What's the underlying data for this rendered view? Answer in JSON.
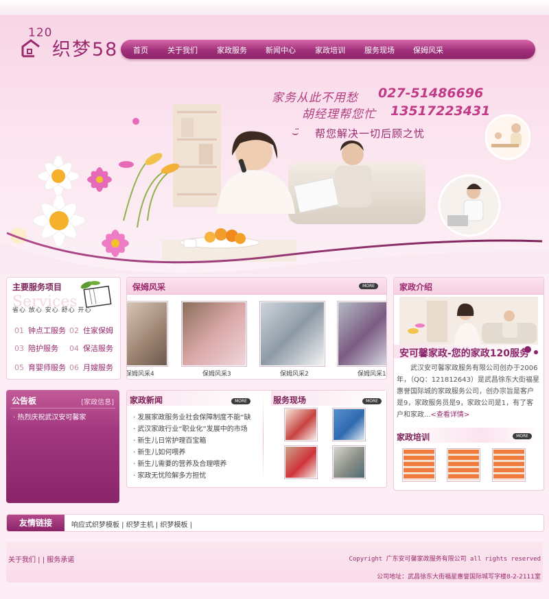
{
  "logo": {
    "number": "120",
    "brand": "织梦58"
  },
  "nav": {
    "items": [
      "首页",
      "关于我们",
      "家政服务",
      "新闻中心",
      "家政培训",
      "服务现场",
      "保姆风采"
    ]
  },
  "banner": {
    "slogan_line1": "家务从此不用愁",
    "slogan_line2": "胡经理帮您忙",
    "phone1": "027-51486696",
    "phone2": "13517223431",
    "slogan_line3": "帮您解决一切后顾之忧",
    "slogan_icon": "smile-icon"
  },
  "services": {
    "title": "主要服务项目",
    "bg_word": "Services",
    "tags": "省心  放心  安心  舒心  开心",
    "items": [
      {
        "num": "01",
        "label": "钟点工服务"
      },
      {
        "num": "02",
        "label": "住家保姆"
      },
      {
        "num": "03",
        "label": "陪护服务"
      },
      {
        "num": "04",
        "label": "保洁服务"
      },
      {
        "num": "05",
        "label": "育婴师服务"
      },
      {
        "num": "06",
        "label": "月嫂服务"
      }
    ]
  },
  "more_label": "MORE",
  "nanny": {
    "title": "保姆风采",
    "captions": [
      "保姆风采4",
      "保姆风采3",
      "保姆风采2",
      "保姆风采1"
    ]
  },
  "about": {
    "title": "家政介绍",
    "headline": "安可馨家政-您的家政120服务",
    "text": "武汉安可馨家政服务有限公司创办于2006年，（QQ：121812643）是武昌徐东大街福星惠誉国际城的家政服务公司，创办宗旨是客户是9，家政服务员是9，家政公司是1，有了客户和家政...",
    "detail_link": "<查看详情>"
  },
  "notice": {
    "title": "公告板",
    "tag": "[家政信息]",
    "items": [
      "· 热烈庆祝武汉安可馨家"
    ]
  },
  "news": {
    "title": "家政新闻",
    "items": [
      "· 发展家政服务业社会保障制度不能“缺",
      "· 武汉家政行业“职业化”发展中的市场",
      "· 新生儿日常护理百宝箱",
      "· 新生儿如何喂养",
      "· 新生儿需要的营养及合理喂养",
      "· 家政无忧险解多方担忧"
    ]
  },
  "site": {
    "title": "服务现场"
  },
  "training": {
    "title": "家政培训"
  },
  "friend": {
    "title": "友情链接",
    "links": "响应式织梦模板  |  织梦主机  |  织梦模板  |"
  },
  "footer": {
    "left": "关于我们  |  |  服务承诺",
    "copyright": "Copyright 广东安可馨家政服务有限公司 all rights reserved",
    "address": "公司地址：武昌徐东大街福星惠誉国际城写字楼8-2-2111室"
  },
  "colors": {
    "brand": "#9a2a6e",
    "nav_top": "#d767a7",
    "nav_bottom": "#8c2469",
    "page_bg": "#fdeef5"
  }
}
